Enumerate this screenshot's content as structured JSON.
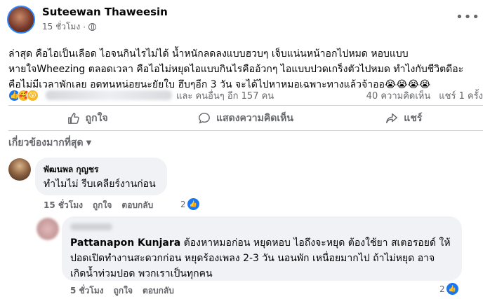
{
  "post": {
    "author": "Suteewan Thaweesin",
    "time": "15 ชั่วโมง",
    "more_icon": "more-horizontal-icon",
    "privacy_icon": "globe-icon",
    "text_lines": [
      "ล่าสุด คือไอเป็นเลือด ไอจนกินไรไม่ได้ น้ำหนักลดลงแบบฮวบๆ เจ็บแน่นหน้าอกไปหมด หอบแบบ",
      "หายใจWheezing ตลอดเวลา คือไอไม่หยุดไอแบบกินไรคืออ้วกๆ ไอแบบปวดเกร็งตัวไปหมด ทำไงกับชีวิตดีอะ",
      "คือไม่มีเวลาพักเลย อดทนหน่อยนะยัยใบ ฮึบๆอีก 3 วัน จะได้ไปหาหมอเฉพาะทางแล้วจ้าออ😭😭😭😭"
    ],
    "reactions_icons": [
      "like-reaction",
      "care-reaction",
      "haha-reaction"
    ],
    "reactions_others": "และ คนอื่นๆ อีก 157 คน",
    "comments_count": "40 ความคิดเห็น",
    "shares_count": "แชร์ 1 ครั้ง"
  },
  "actions": {
    "like": "ถูกใจ",
    "comment": "แสดงความคิดเห็น",
    "share": "แชร์"
  },
  "sort_label": "เกี่ยวข้องมากที่สุด",
  "comments": [
    {
      "name": "พัฒนพล กุญชร",
      "text": "ทำไมไม่ รีบเคลียร์งานก่อน",
      "time": "15 ชั่วโมง",
      "like": "ถูกใจ",
      "reply": "ตอบกลับ",
      "reaction_count": "2"
    },
    {
      "mention": "Pattanapon Kunjara",
      "text_lines": [
        " ต้องหาหมอก่อน หยุดหอบ ไอถึงจะหยุด ต้องใช้ยา สเตอรอยด์ ให้",
        "ปอดเปิดทำงานสะดวกก่อน หยุดร้องเพลง 2-3 วัน นอนพัก เหนื่อยมากไป ถ้าไม่หยุด อาจ",
        "เกิดน้ำท่วมปอด พวกเราเป็นทุกคน"
      ],
      "time": "5 ชั่วโมง",
      "like": "ถูกใจ",
      "reply": "ตอบกลับ",
      "reaction_count": "2"
    }
  ],
  "colors": {
    "accent": "#1877f2",
    "secondary_text": "#65676b",
    "bubble_bg": "#f0f2f5"
  }
}
